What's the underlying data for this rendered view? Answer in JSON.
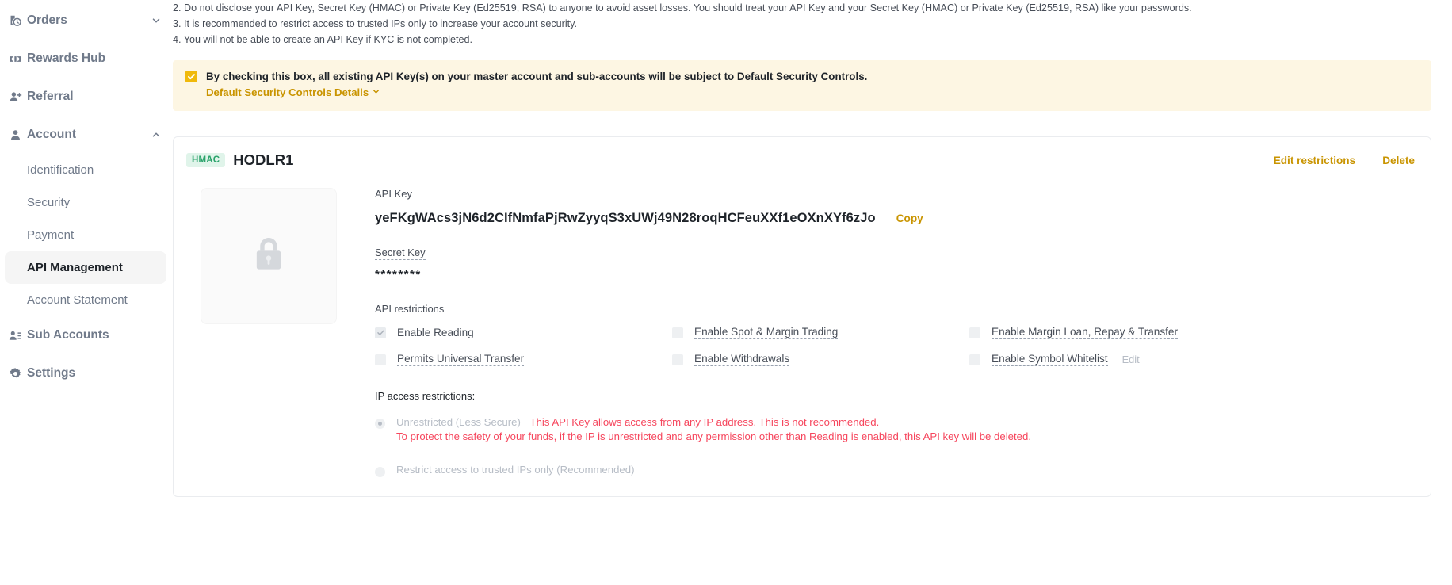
{
  "sidebar": {
    "items": [
      {
        "label": "Orders",
        "icon": "orders-clock-icon",
        "chevron": "chevron-down-icon"
      },
      {
        "label": "Rewards Hub",
        "icon": "ticket-icon",
        "chevron": ""
      },
      {
        "label": "Referral",
        "icon": "user-plus-icon",
        "chevron": ""
      },
      {
        "label": "Account",
        "icon": "user-icon",
        "chevron": "chevron-up-icon"
      },
      {
        "label": "Sub Accounts",
        "icon": "users-list-icon",
        "chevron": ""
      },
      {
        "label": "Settings",
        "icon": "gear-icon",
        "chevron": ""
      }
    ],
    "account_sub_items": [
      {
        "label": "Identification",
        "active": false
      },
      {
        "label": "Security",
        "active": false
      },
      {
        "label": "Payment",
        "active": false
      },
      {
        "label": "API Management",
        "active": true
      },
      {
        "label": "Account Statement",
        "active": false
      }
    ]
  },
  "notes": [
    "2. Do not disclose your API Key, Secret Key (HMAC) or Private Key (Ed25519, RSA) to anyone to avoid asset losses. You should treat your API Key and your Secret Key (HMAC) or Private Key (Ed25519, RSA) like your passwords.",
    "3. It is recommended to restrict access to trusted IPs only to increase your account security.",
    "4. You will not be able to create an API Key if KYC is not completed."
  ],
  "banner": {
    "checkbox_checked": true,
    "checkbox_icon": "check-icon",
    "text": "By checking this box, all existing API Key(s) on your master account and sub-accounts will be subject to Default Security Controls.",
    "link_label": "Default Security Controls Details",
    "link_icon": "chevron-down-icon",
    "bg_color": "#fdf6e3",
    "accent_color": "#f0b90b",
    "link_color": "#c99400"
  },
  "card": {
    "badge": "HMAC",
    "badge_bg": "#e0f4ea",
    "badge_color": "#2aa36b",
    "title": "HODLR1",
    "edit_restrictions_label": "Edit restrictions",
    "delete_label": "Delete",
    "action_color": "#c99400",
    "lock_icon": "lock-icon",
    "api_key_label": "API Key",
    "api_key_value": "yeFKgWAcs3jN6d2CIfNmfaPjRwZyyqS3xUWj49N28roqHCFeuXXf1eOXnXYf6zJo",
    "copy_label": "Copy",
    "secret_key_label": "Secret Key",
    "secret_key_value": "********",
    "api_restrictions_label": "API restrictions",
    "restrictions": [
      {
        "label": "Enable Reading",
        "checked": true,
        "dashed": false,
        "edit_label": ""
      },
      {
        "label": "Enable Spot & Margin Trading",
        "checked": false,
        "dashed": true,
        "edit_label": ""
      },
      {
        "label": "Enable Margin Loan, Repay & Transfer",
        "checked": false,
        "dashed": true,
        "edit_label": ""
      },
      {
        "label": "Permits Universal Transfer",
        "checked": false,
        "dashed": true,
        "edit_label": ""
      },
      {
        "label": "Enable Withdrawals",
        "checked": false,
        "dashed": true,
        "edit_label": ""
      },
      {
        "label": "Enable Symbol Whitelist",
        "checked": false,
        "dashed": true,
        "edit_label": "Edit"
      }
    ],
    "ip_section_label": "IP access restrictions:",
    "ip_options": [
      {
        "name": "Unrestricted (Less Secure)",
        "warning": "This API Key allows access from any IP address. This is not recommended.",
        "warning_line2": "To protect the safety of your funds, if the IP is unrestricted and any permission other than Reading is enabled, this API key will be deleted.",
        "selected": true
      },
      {
        "name": "Restrict access to trusted IPs only (Recommended)",
        "warning": "",
        "warning_line2": "",
        "selected": false
      }
    ],
    "warning_color": "#f6465d"
  }
}
